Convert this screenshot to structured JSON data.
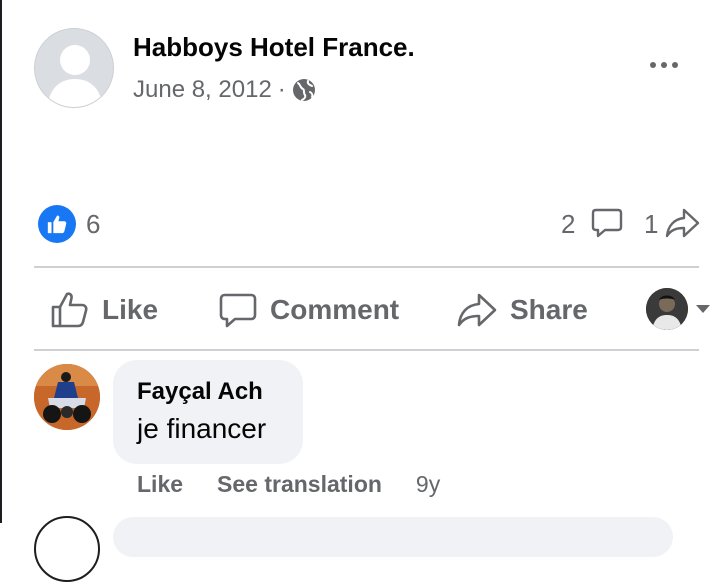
{
  "post": {
    "author": "Habboys Hotel France.",
    "date": "June 8, 2012",
    "separator": "·",
    "privacy_icon": "globe-icon",
    "more_icon": "more-options-icon"
  },
  "stats": {
    "reaction_icon": "like-reaction-icon",
    "reaction_count": "6",
    "comment_count": "2",
    "share_count": "1"
  },
  "actions": {
    "like_label": "Like",
    "comment_label": "Comment",
    "share_label": "Share"
  },
  "comments": [
    {
      "author": "Fayçal Ach",
      "text": "je financer",
      "like_label": "Like",
      "translate_label": "See translation",
      "time": "9y"
    }
  ],
  "colors": {
    "brand_blue": "#1877f2",
    "text_primary": "#050505",
    "text_secondary": "#65676b",
    "bubble_bg": "#f0f2f5",
    "divider": "#ced0d4"
  }
}
